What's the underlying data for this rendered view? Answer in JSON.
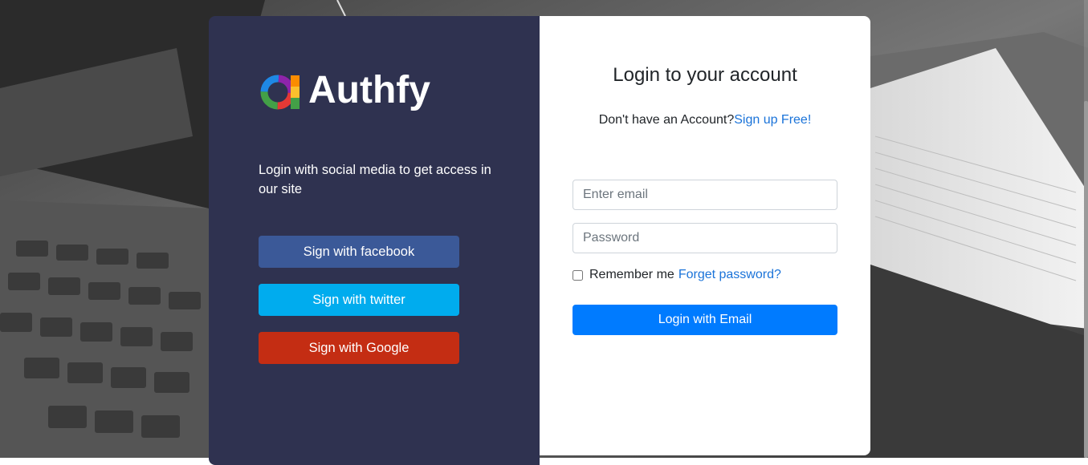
{
  "brand": {
    "name": "Authfy",
    "logo_icon": "authfy-logo-icon"
  },
  "left": {
    "tagline": "Login with social media to get access in our site",
    "buttons": {
      "facebook": "Sign with facebook",
      "twitter": "Sign with twitter",
      "google": "Sign with Google"
    }
  },
  "right": {
    "title": "Login to your account",
    "signup_prompt": "Don't have an Account?",
    "signup_link": "Sign up Free!",
    "email_placeholder": "Enter email",
    "password_placeholder": "Password",
    "remember_label": "Remember me",
    "remember_checked": false,
    "forget_link": "Forget password?",
    "login_button": "Login with Email"
  },
  "colors": {
    "left_panel": "#2f3250",
    "facebook": "#3b5998",
    "twitter": "#00acee",
    "google": "#c42d13",
    "primary": "#007bff",
    "link": "#1a73d9"
  }
}
